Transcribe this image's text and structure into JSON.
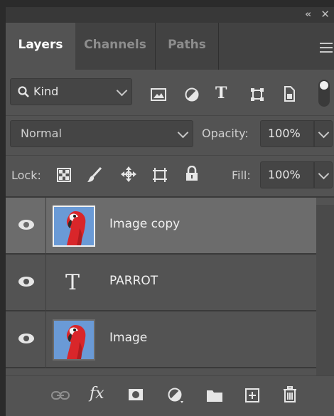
{
  "panel": {
    "collapse_glyph": "‹‹",
    "close_glyph": "✕",
    "tabs": [
      {
        "label": "Layers",
        "active": true
      },
      {
        "label": "Channels",
        "active": false
      },
      {
        "label": "Paths",
        "active": false
      }
    ]
  },
  "filter": {
    "label": "Kind",
    "icons": [
      "image-filter-icon",
      "adjustment-filter-icon",
      "type-filter-icon",
      "shape-filter-icon",
      "smart-object-filter-icon",
      "filter-toggle"
    ]
  },
  "blend": {
    "mode": "Normal",
    "opacity_label": "Opacity:",
    "opacity_value": "100%"
  },
  "lock": {
    "label": "Lock:",
    "icons": [
      "lock-transparent-pixels-icon",
      "lock-image-pixels-icon",
      "lock-position-icon",
      "prevent-auto-nesting-icon",
      "lock-all-icon"
    ],
    "fill_label": "Fill:",
    "fill_value": "100%"
  },
  "layers": [
    {
      "name": "Image copy",
      "kind": "image",
      "selected": true,
      "visible": true
    },
    {
      "name": "PARROT",
      "kind": "type",
      "selected": false,
      "visible": true
    },
    {
      "name": "Image",
      "kind": "image",
      "selected": false,
      "visible": true
    }
  ],
  "bottom_icons": [
    "link-layers-icon",
    "layer-style-icon",
    "add-mask-icon",
    "new-adjustment-layer-icon",
    "new-group-icon",
    "new-layer-icon",
    "delete-layer-icon"
  ],
  "colors": {
    "panel": "#535353",
    "selected_row": "#6c6c6c",
    "tabs_bg": "#424242"
  }
}
